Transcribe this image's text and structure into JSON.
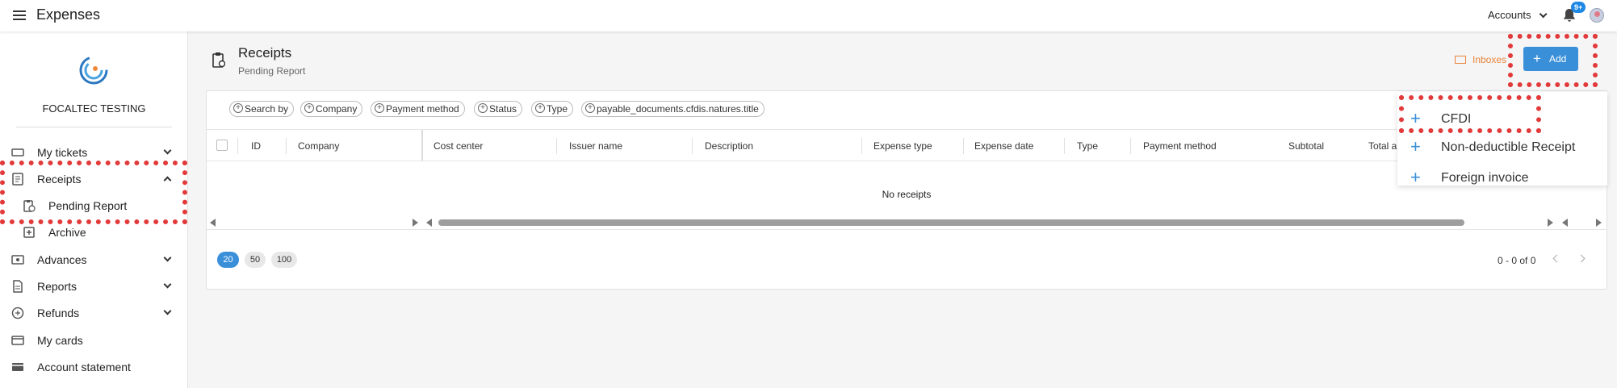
{
  "topbar": {
    "menu_icon": "hamburger-menu-icon",
    "app_title": "Expenses",
    "accounts_label": "Accounts",
    "notification_badge": "9+"
  },
  "sidebar": {
    "company_name": "FOCALTEC TESTING",
    "items": [
      {
        "label": "My tickets",
        "icon": "ticket-icon"
      },
      {
        "label": "Receipts",
        "icon": "receipt-icon"
      },
      {
        "label": "Pending Report",
        "icon": "pending-report-icon"
      },
      {
        "label": "Archive",
        "icon": "archive-icon"
      },
      {
        "label": "Advances",
        "icon": "advances-icon"
      },
      {
        "label": "Reports",
        "icon": "reports-icon"
      },
      {
        "label": "Refunds",
        "icon": "refunds-icon"
      },
      {
        "label": "My cards",
        "icon": "card-icon"
      },
      {
        "label": "Account statement",
        "icon": "statement-icon"
      }
    ]
  },
  "header": {
    "title": "Receipts",
    "subtitle": "Pending Report",
    "inboxes_label": "Inboxes",
    "add_label": "Add"
  },
  "filters": [
    "Search by",
    "Company",
    "Payment method",
    "Status",
    "Type",
    "payable_documents.cfdis.natures.title"
  ],
  "table": {
    "columns": [
      "ID",
      "Company",
      "Cost center",
      "Issuer name",
      "Description",
      "Expense type",
      "Expense date",
      "Type",
      "Payment method",
      "Subtotal",
      "Total a"
    ],
    "empty_text": "No receipts"
  },
  "pagination": {
    "page_sizes": [
      "20",
      "50",
      "100"
    ],
    "active_size": "20",
    "range": "0 - 0 of 0"
  },
  "add_menu": {
    "items": [
      "CFDI",
      "Non-deductible Receipt",
      "Foreign invoice"
    ]
  },
  "colors": {
    "accent": "#3a8fd9",
    "inboxes": "#e8833a",
    "highlight": "#e23a3a"
  }
}
